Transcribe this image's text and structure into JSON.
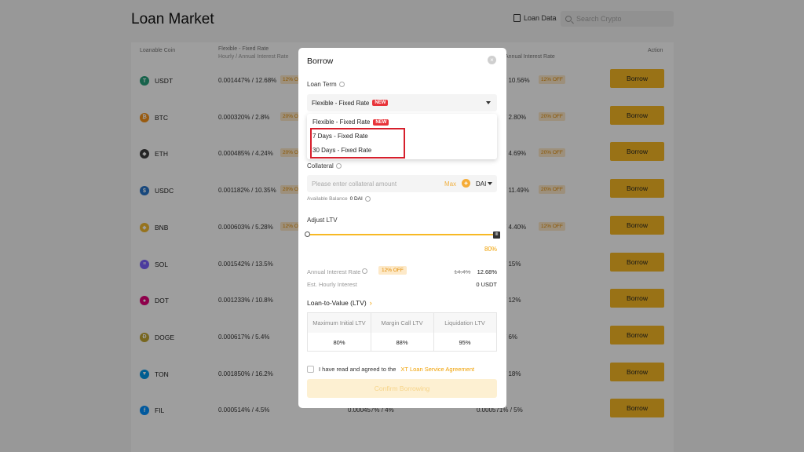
{
  "page": {
    "title": "Loan Market",
    "loan_data_label": "Loan Data",
    "search_placeholder": "Search Crypto"
  },
  "table": {
    "headers": {
      "coin": "Loanable Coin",
      "flex_title": "Flexible - Fixed Rate",
      "flex_sub": "Hourly / Annual Interest Rate",
      "fixed_sub": "Annual Interest Rate",
      "action": "Action"
    },
    "borrow_label": "Borrow",
    "rows": [
      {
        "coin": "USDT",
        "icon_color": "#26a17b",
        "icon_glyph": "T",
        "rate": "0.001447% / 12.68%",
        "off": "12% OFF",
        "rate2": "/ 10.56%",
        "off2": "12% OFF"
      },
      {
        "coin": "BTC",
        "icon_color": "#f7931a",
        "icon_glyph": "₿",
        "rate": "0.000320% / 2.8%",
        "off": "20% OFF",
        "rate2": "/ 2.80%",
        "off2": "20% OFF"
      },
      {
        "coin": "ETH",
        "icon_color": "#3c3c3d",
        "icon_glyph": "◆",
        "rate": "0.000485% / 4.24%",
        "off": "20% OFF",
        "rate2": "/ 4.69%",
        "off2": "20% OFF"
      },
      {
        "coin": "USDC",
        "icon_color": "#2775ca",
        "icon_glyph": "$",
        "rate": "0.001182% / 10.35%",
        "off": "20% OFF",
        "rate2": "/ 11.49%",
        "off2": "20% OFF"
      },
      {
        "coin": "BNB",
        "icon_color": "#f3ba2f",
        "icon_glyph": "◆",
        "rate": "0.000603% / 5.28%",
        "off": "12% OFF",
        "rate2": "/ 4.40%",
        "off2": "12% OFF"
      },
      {
        "coin": "SOL",
        "icon_color": "#7b61ff",
        "icon_glyph": "≡",
        "rate": "0.001542% / 13.5%",
        "off": "",
        "rate2": "/ 15%",
        "off2": ""
      },
      {
        "coin": "DOT",
        "icon_color": "#e6007a",
        "icon_glyph": "●",
        "rate": "0.001233% / 10.8%",
        "off": "",
        "rate2": "/ 12%",
        "off2": ""
      },
      {
        "coin": "DOGE",
        "icon_color": "#c2a633",
        "icon_glyph": "Ð",
        "rate": "0.000617% / 5.4%",
        "off": "",
        "rate2": "/ 6%",
        "off2": ""
      },
      {
        "coin": "TON",
        "icon_color": "#0098ea",
        "icon_glyph": "▼",
        "rate": "0.001850% / 16.2%",
        "off": "",
        "rate2": "/ 18%",
        "off2": ""
      },
      {
        "coin": "FIL",
        "icon_color": "#0090ff",
        "icon_glyph": "f",
        "rate": "0.000514% / 4.5%",
        "off": "",
        "rate2": "0.000571% / 5%",
        "off2": ""
      }
    ],
    "fil_mid": "0.000457% / 4%"
  },
  "modal": {
    "title": "Borrow",
    "close_glyph": "×",
    "loan_term_label": "Loan Term",
    "selected_term": "Flexible - Fixed Rate",
    "new_badge": "NEW",
    "options": [
      {
        "label": "Flexible - Fixed Rate",
        "new": true
      },
      {
        "label": "7 Days - Fixed Rate",
        "new": false
      },
      {
        "label": "30 Days - Fixed Rate",
        "new": false
      }
    ],
    "collateral_label": "Collateral",
    "collateral_placeholder": "Please enter collateral amount",
    "max_label": "Max",
    "collateral_coin": "DAI",
    "available_label": "Available Balance",
    "available_value": "0 DAI",
    "adjust_ltv_label": "Adjust LTV",
    "ltv_value_text": "80%",
    "ltv_fraction": 1.0,
    "annual_rate_label": "Annual Interest Rate",
    "annual_off": "12% OFF",
    "annual_old": "14.4%",
    "annual_new": "12.68%",
    "hourly_label": "Est. Hourly Interest",
    "hourly_value": "0 USDT",
    "ltv_section_title": "Loan-to-Value (LTV)",
    "ltv_headers": [
      "Maximum Initial LTV",
      "Margin Call LTV",
      "Liquidation LTV"
    ],
    "ltv_values": [
      "80%",
      "88%",
      "95%"
    ],
    "agree_text": "I have read and agreed to the",
    "agree_link": "XT Loan Service Agreement",
    "confirm_label": "Confirm Borrowing"
  },
  "colors": {
    "accent": "#f7b924",
    "highlight_border": "#d61f2c",
    "new_badge": "#e8343a"
  }
}
